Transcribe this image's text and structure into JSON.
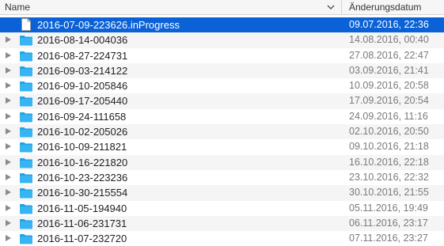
{
  "header": {
    "name_label": "Name",
    "date_label": "Änderungsdatum"
  },
  "rows": [
    {
      "name": "2016-07-09-223626.inProgress",
      "date": "09.07.2016, 22:36",
      "kind": "document-icon",
      "selected": true
    },
    {
      "name": "2016-08-14-004036",
      "date": "14.08.2016, 00:40",
      "kind": "folder-icon"
    },
    {
      "name": "2016-08-27-224731",
      "date": "27.08.2016, 22:47",
      "kind": "folder-icon"
    },
    {
      "name": "2016-09-03-214122",
      "date": "03.09.2016, 21:41",
      "kind": "folder-icon"
    },
    {
      "name": "2016-09-10-205846",
      "date": "10.09.2016, 20:58",
      "kind": "folder-icon"
    },
    {
      "name": "2016-09-17-205440",
      "date": "17.09.2016, 20:54",
      "kind": "folder-icon"
    },
    {
      "name": "2016-09-24-111658",
      "date": "24.09.2016, 11:16",
      "kind": "folder-icon"
    },
    {
      "name": "2016-10-02-205026",
      "date": "02.10.2016, 20:50",
      "kind": "folder-icon"
    },
    {
      "name": "2016-10-09-211821",
      "date": "09.10.2016, 21:18",
      "kind": "folder-icon"
    },
    {
      "name": "2016-10-16-221820",
      "date": "16.10.2016, 22:18",
      "kind": "folder-icon"
    },
    {
      "name": "2016-10-23-223236",
      "date": "23.10.2016, 22:32",
      "kind": "folder-icon"
    },
    {
      "name": "2016-10-30-215554",
      "date": "30.10.2016, 21:55",
      "kind": "folder-icon"
    },
    {
      "name": "2016-11-05-194940",
      "date": "05.11.2016, 19:49",
      "kind": "folder-icon"
    },
    {
      "name": "2016-11-06-231731",
      "date": "06.11.2016, 23:17",
      "kind": "folder-icon"
    },
    {
      "name": "2016-11-07-232720",
      "date": "07.11.2016, 23:27",
      "kind": "folder-icon"
    }
  ],
  "colors": {
    "selection": "#0a62d6",
    "folder": "#37b4f2",
    "date_text": "#7a7a7a"
  }
}
